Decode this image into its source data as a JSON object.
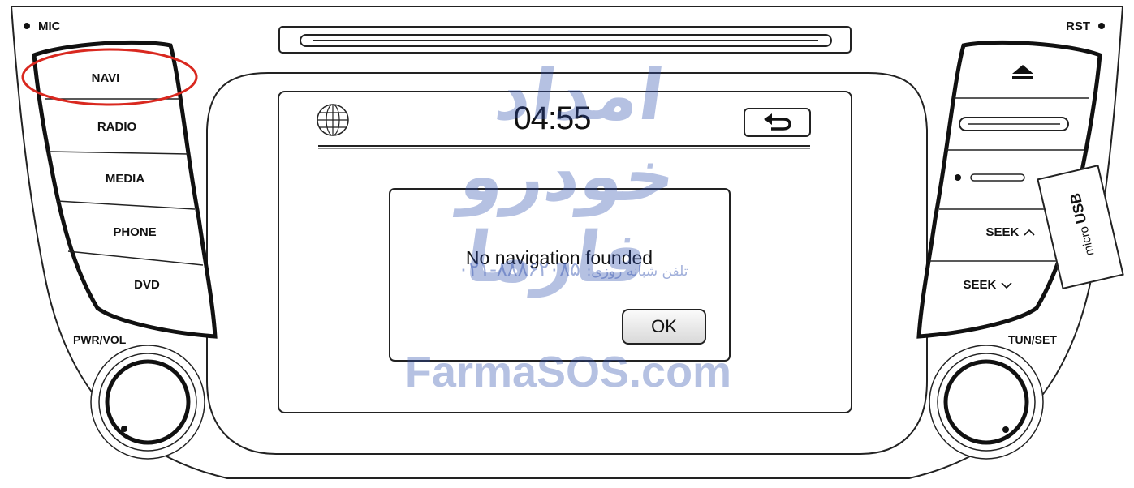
{
  "panel": {
    "mic_label": "MIC",
    "rst_label": "RST",
    "pwr_vol_label": "PWR/VOL",
    "tun_set_label": "TUN/SET",
    "left_buttons": [
      "NAVI",
      "RADIO",
      "MEDIA",
      "PHONE",
      "DVD"
    ],
    "seek_up_label": "SEEK",
    "seek_down_label": "SEEK",
    "usb_label_small": "micro",
    "usb_label_big": "USB"
  },
  "screen": {
    "time": "04:55",
    "dialog_message": "No navigation founded",
    "ok_label": "OK"
  },
  "watermark": {
    "brand_fa": "امداد خودرو فارما",
    "phone_caption_fa": "تلفن شبانه روزی:",
    "phone_number_fa": "۰۲۱-۸۸۸۶۲۰۸۵",
    "site": "FarmaSOS.com"
  },
  "colors": {
    "highlight_ring": "#d9281f",
    "watermark": "#2f4fae",
    "line": "#222222"
  },
  "icons": [
    "globe-icon",
    "back-arrow-icon",
    "eject-icon",
    "cd-slot-icon",
    "chevron-up-icon",
    "chevron-down-icon"
  ]
}
